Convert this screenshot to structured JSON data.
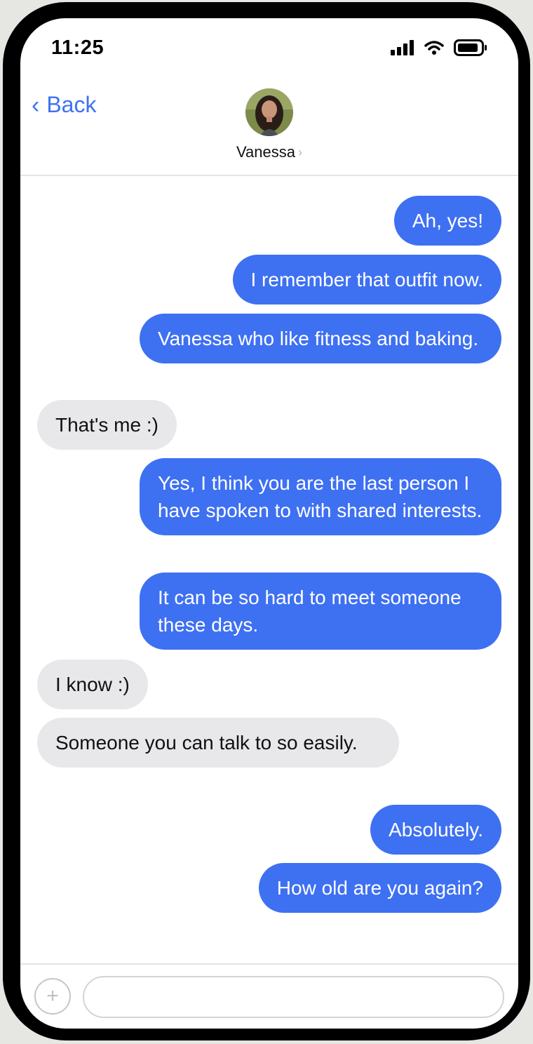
{
  "status_bar": {
    "time": "11:25",
    "icons": [
      "signal-icon",
      "wifi-icon",
      "battery-icon"
    ]
  },
  "header": {
    "back_label": "Back",
    "back_chevron": "‹",
    "contact_name": "Vanessa",
    "name_chevron": "›"
  },
  "messages": [
    {
      "direction": "sent",
      "text": "Ah, yes!"
    },
    {
      "direction": "sent",
      "text": "I remember that outfit now."
    },
    {
      "direction": "sent",
      "text": "Vanessa who like fitness and baking."
    },
    {
      "direction": "received",
      "text": "That's me :)"
    },
    {
      "direction": "sent",
      "text": "Yes, I think you are the last person I have spoken to with shared interests."
    },
    {
      "direction": "sent",
      "text": "It can be so hard to meet someone these days."
    },
    {
      "direction": "received",
      "text": "I know :)"
    },
    {
      "direction": "received",
      "text": "Someone you can talk to so easily."
    },
    {
      "direction": "sent",
      "text": "Absolutely."
    },
    {
      "direction": "sent",
      "text": "How old are you again?"
    }
  ],
  "composer": {
    "plus_label": "+",
    "input_value": "",
    "input_placeholder": ""
  },
  "colors": {
    "accent": "#3e72f0",
    "sent_bubble": "#3e70f2",
    "received_bubble": "#e8e8ea"
  }
}
